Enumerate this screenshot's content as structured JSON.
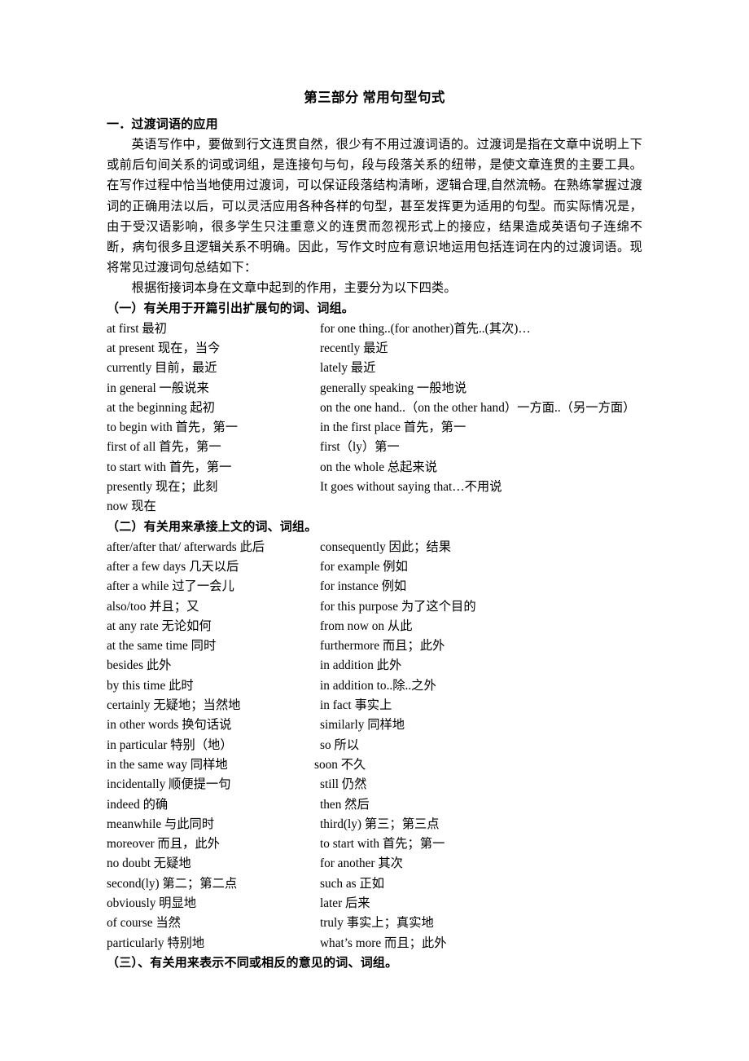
{
  "document": {
    "title": "第三部分 常用句型句式",
    "section_heading": "一．过渡词语的应用",
    "paragraphs": [
      "英语写作中，要做到行文连贯自然，很少有不用过渡词语的。过渡词是指在文章中说明上下或前后句间关系的词或词组，是连接句与句，段与段落关系的纽带，是使文章连贯的主要工具。在写作过程中恰当地使用过渡词，可以保证段落结构清晰，逻辑合理,自然流畅。在熟练掌握过渡词的正确用法以后，可以灵活应用各种各样的句型，甚至发挥更为适用的句型。而实际情况是，由于受汉语影响，很多学生只注重意义的连贯而忽视形式上的接应，结果造成英语句子连绵不断，病句很多且逻辑关系不明确。因此，写作文时应有意识地运用包括连词在内的过渡词语。现将常见过渡词句总结如下：",
      "根据衔接词本身在文章中起到的作用，主要分为以下四类。"
    ],
    "subsections": [
      {
        "heading": "（一）有关用于开篇引出扩展句的词、词组。",
        "rows": [
          {
            "left": "at first  最初",
            "right": "for one thing..(for another)首先..(其次)…",
            "right_indent": 0
          },
          {
            "left": "at present  现在，当今",
            "right": "recently  最近",
            "right_indent": 0
          },
          {
            "left": "currently  目前，最近",
            "right": "lately 最近",
            "right_indent": 0
          },
          {
            "left": "in general  一般说来",
            "right": "generally speaking  一般地说",
            "right_indent": 1
          },
          {
            "left": "at the beginning  起初",
            "right": "on the one hand..（on the other hand）一方面..（另一方面）",
            "right_indent": 0
          },
          {
            "left": "to begin with  首先，第一",
            "right": "in the first place  首先，第一",
            "right_indent": 0
          },
          {
            "left": "first of all  首先，第一",
            "right": "first（ly）第一",
            "right_indent": 0
          },
          {
            "left": "to start with  首先，第一",
            "right": "on the whole 总起来说",
            "right_indent": 0
          },
          {
            "left": "presently  现在；此刻",
            "right": "It goes without saying that…不用说",
            "right_indent": 1
          },
          {
            "left": "now  现在",
            "right": "",
            "right_indent": 0
          }
        ]
      },
      {
        "heading": "（二）有关用来承接上文的词、词组。",
        "rows": [
          {
            "left": "after/after that/ afterwards  此后",
            "right": "consequently  因此；结果",
            "right_indent": 0
          },
          {
            "left": "after a few days  几天以后",
            "right": "for example    例如",
            "right_indent": 0
          },
          {
            "left": "after a while  过了一会儿",
            "right": "for instance    例如",
            "right_indent": 1
          },
          {
            "left": "also/too  并且；又",
            "right": "for this purpose  为了这个目的",
            "right_indent": 0
          },
          {
            "left": "at any rate  无论如何",
            "right": "from now on  从此",
            "right_indent": 1
          },
          {
            "left": "at the same time  同时",
            "right": "furthermore  而且；此外",
            "right_indent": 0
          },
          {
            "left": "besides    此外",
            "right": "in addition  此外",
            "right_indent": 0
          },
          {
            "left": "by this time  此时",
            "right": "in addition to..除..之外",
            "right_indent": 0
          },
          {
            "left": "certainly  无疑地；当然地",
            "right": "in fact  事实上",
            "right_indent": 0
          },
          {
            "left": "in other words  换句话说",
            "right": "similarly  同样地",
            "right_indent": 1
          },
          {
            "left": "in particular  特别（地）",
            "right": "so  所以",
            "right_indent": 1
          },
          {
            "left": "in the same way  同样地",
            "right": "soon  不久",
            "right_indent": 3
          },
          {
            "left": "incidentally  顺便提一句",
            "right": "still  仍然",
            "right_indent": 1
          },
          {
            "left": "indeed 的确",
            "right": "then  然后",
            "right_indent": 1
          },
          {
            "left": "meanwhile  与此同时",
            "right": "third(ly)  第三；第三点",
            "right_indent": 0
          },
          {
            "left": "moreover 而且，此外",
            "right": "to start with  首先；第一",
            "right_indent": 0
          },
          {
            "left": "no doubt  无疑地",
            "right": "for another  其次",
            "right_indent": 0
          },
          {
            "left": "second(ly)  第二；第二点",
            "right": "such as  正如",
            "right_indent": 0
          },
          {
            "left": "obviously  明显地",
            "right": "later  后来",
            "right_indent": 0
          },
          {
            "left": "of course 当然",
            "right": "truly  事实上；真实地",
            "right_indent": 0
          },
          {
            "left": "particularly  特别地",
            "right": "what’s more  而且；此外",
            "right_indent": 0
          }
        ]
      },
      {
        "heading": "（三）、有关用来表示不同或相反的意见的词、词组。",
        "rows": []
      }
    ]
  }
}
